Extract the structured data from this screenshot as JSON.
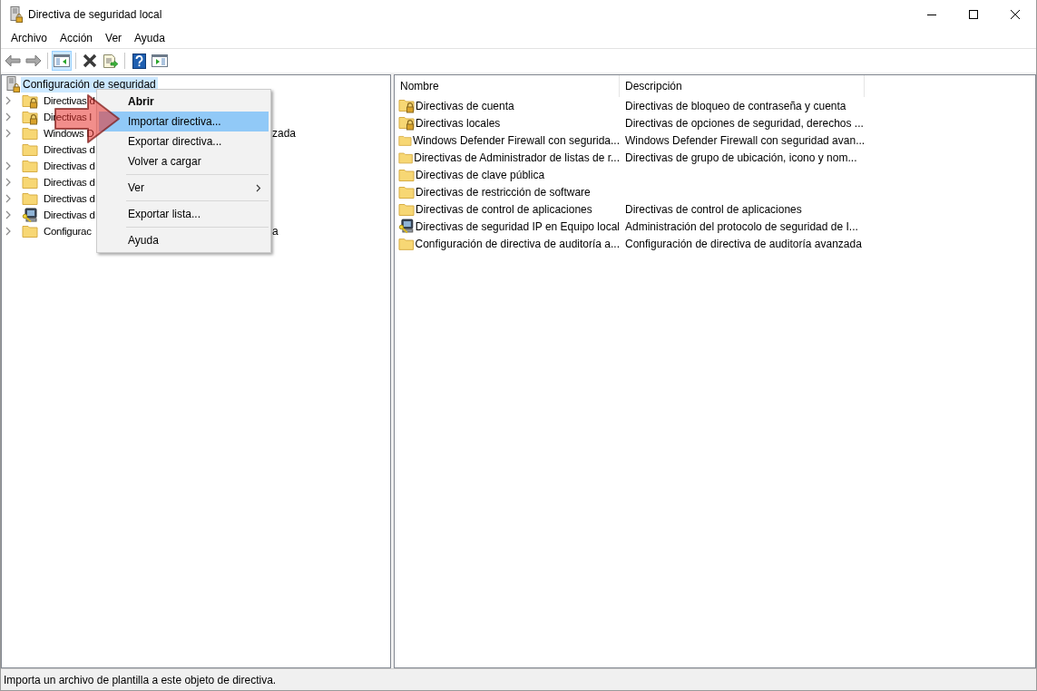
{
  "window": {
    "title": "Directiva de seguridad local"
  },
  "menu_bar": [
    "Archivo",
    "Acción",
    "Ver",
    "Ayuda"
  ],
  "toolbar": [
    {
      "kind": "back",
      "pressed": false
    },
    {
      "kind": "forward",
      "pressed": false
    },
    {
      "kind": "separator"
    },
    {
      "kind": "tree-pane",
      "pressed": true
    },
    {
      "kind": "separator"
    },
    {
      "kind": "delete",
      "pressed": false
    },
    {
      "kind": "export",
      "pressed": false
    },
    {
      "kind": "separator"
    },
    {
      "kind": "help",
      "pressed": false
    },
    {
      "kind": "action-pane",
      "pressed": false
    }
  ],
  "tree": {
    "label": "Configuración de seguridad",
    "selected": true,
    "children": [
      {
        "kind": "lock-folder",
        "label": "Directivas d",
        "has_children": true,
        "selected": false
      },
      {
        "kind": "lock-folder",
        "label": "Directivas l",
        "has_children": true,
        "selected": false
      },
      {
        "kind": "folder",
        "label": "Windows D",
        "tail": "zada",
        "has_children": true,
        "selected": false
      },
      {
        "kind": "folder",
        "label": "Directivas d",
        "has_children": false,
        "selected": false
      },
      {
        "kind": "folder",
        "label": "Directivas d",
        "has_children": true,
        "selected": false
      },
      {
        "kind": "folder",
        "label": "Directivas d",
        "has_children": true,
        "selected": false
      },
      {
        "kind": "folder",
        "label": "Directivas d",
        "has_children": true,
        "selected": false
      },
      {
        "kind": "computer",
        "label": "Directivas d",
        "has_children": true,
        "selected": false
      },
      {
        "kind": "folder",
        "label": "Configurac",
        "tail": "a",
        "has_children": true,
        "selected": false
      }
    ]
  },
  "context_menu": [
    {
      "kind": "item",
      "label": "Abrir",
      "default": true,
      "selected": false
    },
    {
      "kind": "item",
      "label": "Importar directiva...",
      "default": false,
      "selected": true
    },
    {
      "kind": "item",
      "label": "Exportar directiva...",
      "default": false,
      "selected": false
    },
    {
      "kind": "item",
      "label": "Volver a cargar",
      "default": false,
      "selected": false
    },
    {
      "kind": "separator"
    },
    {
      "kind": "submenu",
      "label": "Ver",
      "default": false,
      "selected": false
    },
    {
      "kind": "separator"
    },
    {
      "kind": "item",
      "label": "Exportar lista...",
      "default": false,
      "selected": false
    },
    {
      "kind": "separator"
    },
    {
      "kind": "item",
      "label": "Ayuda",
      "default": false,
      "selected": false
    }
  ],
  "list": {
    "columns": [
      "Nombre",
      "Descripción"
    ],
    "rows": [
      {
        "kind": "lock-folder",
        "name": "Directivas de cuenta",
        "description": "Directivas de bloqueo de contraseña y cuenta"
      },
      {
        "kind": "lock-folder",
        "name": "Directivas locales",
        "description": "Directivas de opciones de seguridad, derechos ..."
      },
      {
        "kind": "folder",
        "name": "Windows Defender Firewall con segurida...",
        "description": "Windows Defender Firewall con seguridad avan..."
      },
      {
        "kind": "folder",
        "name": "Directivas de Administrador de listas de r...",
        "description": "Directivas de grupo de ubicación, icono y nom..."
      },
      {
        "kind": "folder",
        "name": "Directivas de clave pública"
      },
      {
        "kind": "folder",
        "name": "Directivas de restricción de software"
      },
      {
        "kind": "folder",
        "name": "Directivas de control de aplicaciones",
        "description": "Directivas de control de aplicaciones"
      },
      {
        "kind": "computer",
        "name": "Directivas de seguridad IP en Equipo local",
        "description": "Administración del protocolo de seguridad de I..."
      },
      {
        "kind": "folder",
        "name": "Configuración de directiva de auditoría a...",
        "description": "Configuración de directiva de auditoría avanzada"
      }
    ]
  },
  "status_bar": "Importa un archivo de plantilla a este objeto de directiva."
}
